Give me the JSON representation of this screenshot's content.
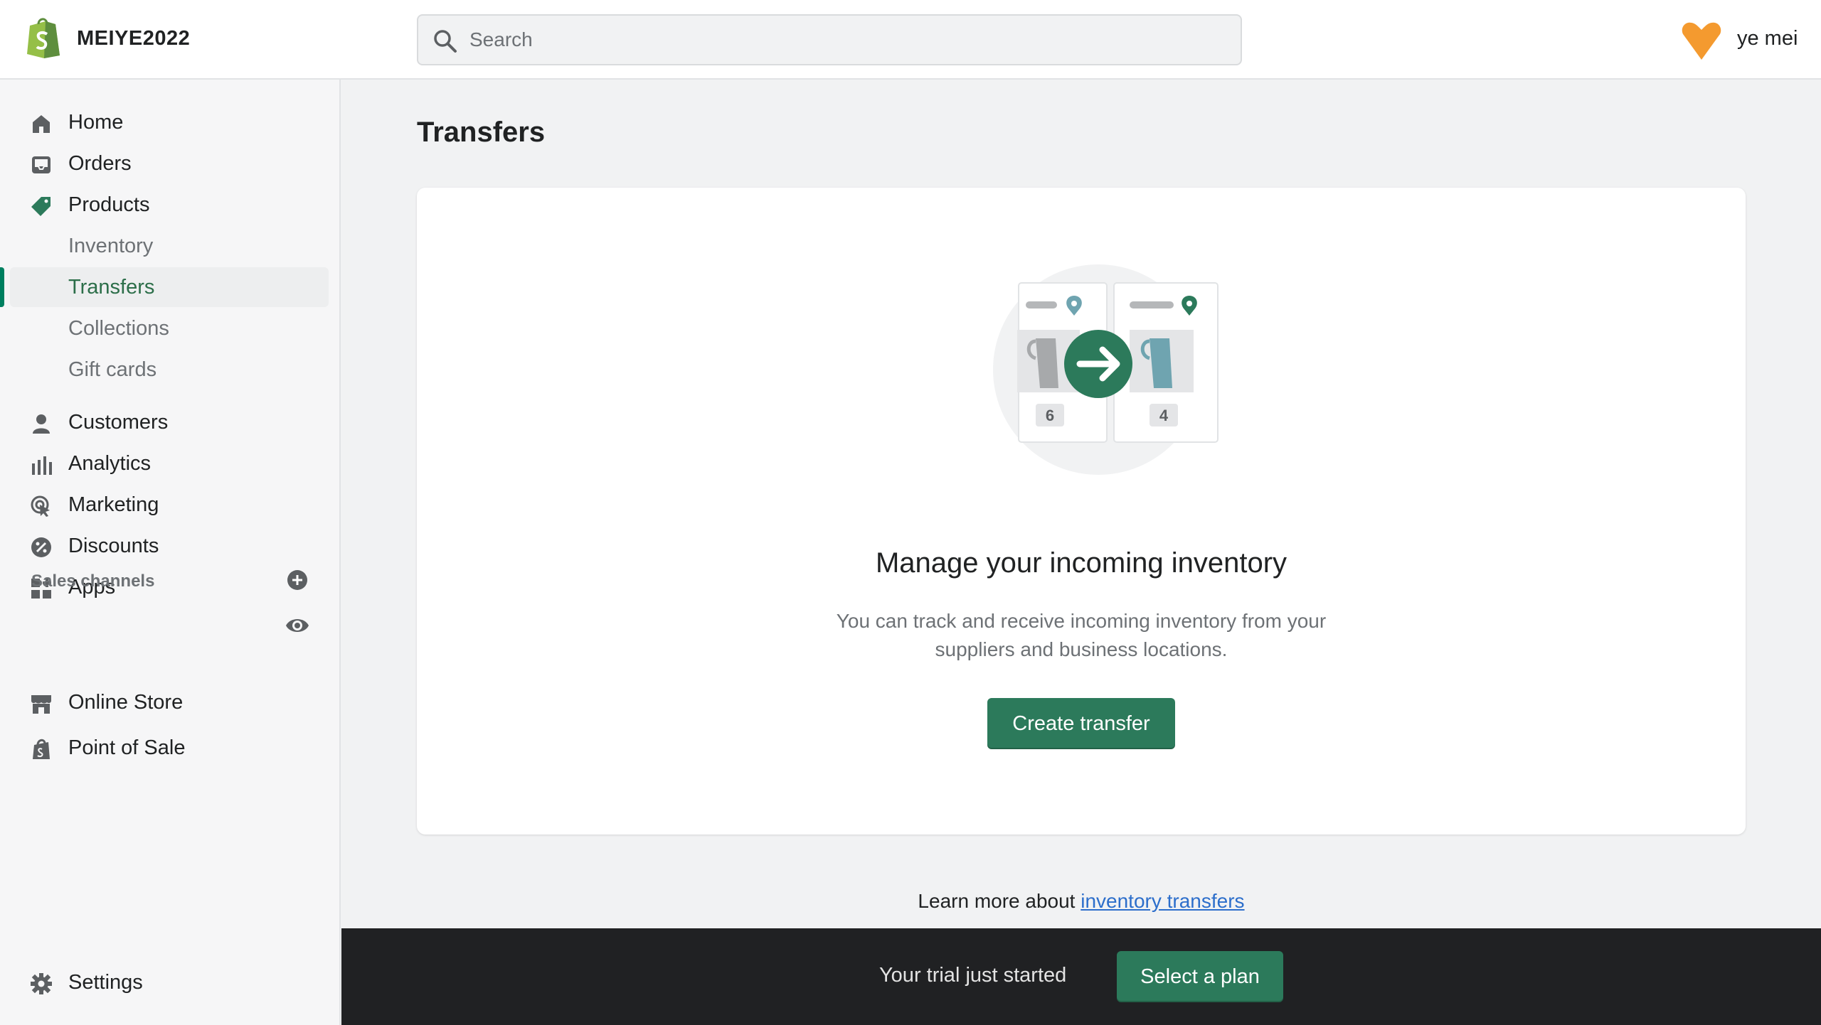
{
  "topbar": {
    "store_name": "MEIYE2022",
    "search_placeholder": "Search",
    "user_name": "ye mei"
  },
  "sidebar": {
    "items": [
      {
        "label": "Home",
        "icon": "home-icon"
      },
      {
        "label": "Orders",
        "icon": "inbox-icon"
      },
      {
        "label": "Products",
        "icon": "tag-icon"
      },
      {
        "label": "Inventory"
      },
      {
        "label": "Transfers"
      },
      {
        "label": "Collections"
      },
      {
        "label": "Gift cards"
      },
      {
        "label": "Customers",
        "icon": "person-icon"
      },
      {
        "label": "Analytics",
        "icon": "bar-chart-icon"
      },
      {
        "label": "Marketing",
        "icon": "target-icon"
      },
      {
        "label": "Discounts",
        "icon": "discount-icon"
      },
      {
        "label": "Apps",
        "icon": "apps-icon"
      }
    ],
    "sales_channels_title": "Sales channels",
    "channels": [
      {
        "label": "Online Store",
        "icon": "store-icon"
      },
      {
        "label": "Point of Sale",
        "icon": "shopping-bag-icon"
      }
    ],
    "settings_label": "Settings"
  },
  "main": {
    "page_title": "Transfers",
    "empty_state": {
      "heading": "Manage your incoming inventory",
      "body": "You can track and receive incoming inventory from your suppliers and business locations.",
      "button_label": "Create transfer",
      "qty_from": "6",
      "qty_to": "4"
    },
    "learn_more_prefix": "Learn more about ",
    "learn_more_link": "inventory transfers"
  },
  "trial_bar": {
    "text": "Your trial just started",
    "button_label": "Select a plan"
  },
  "colors": {
    "accent": "#2c7a5b",
    "active_text": "#2c6e49",
    "avatar": "#f49a2f",
    "trial_bg": "#202123"
  }
}
